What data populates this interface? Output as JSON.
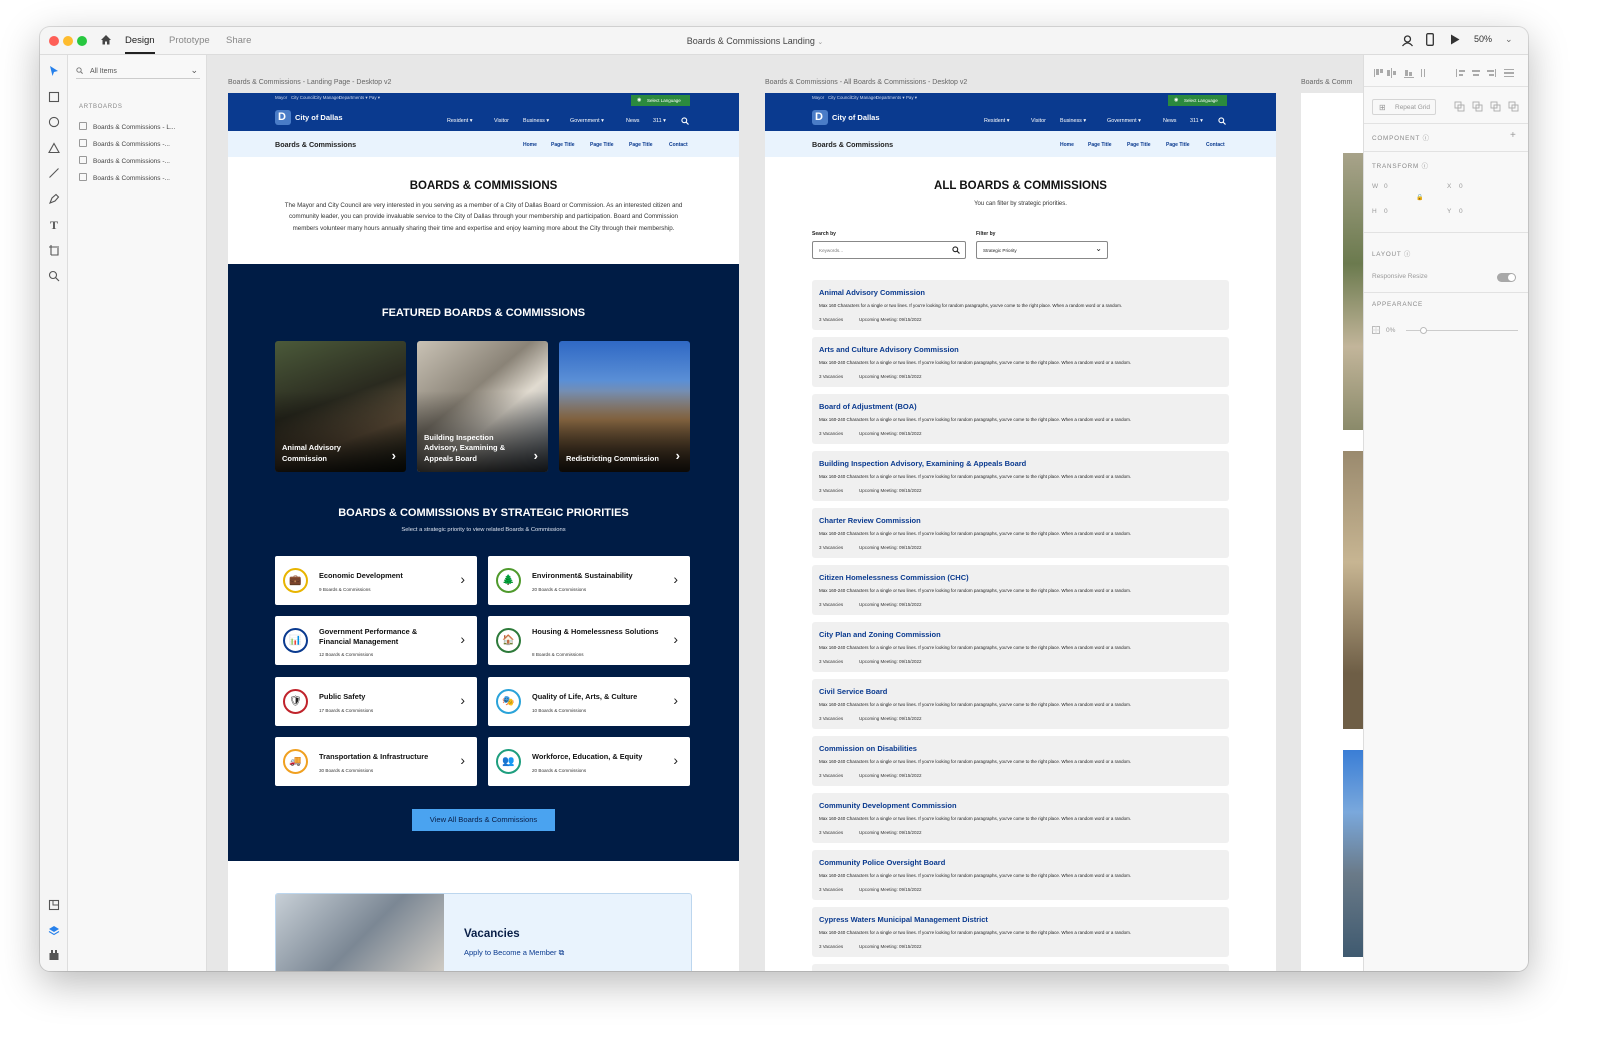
{
  "window": {
    "tabs": [
      "Design",
      "Prototype",
      "Share"
    ],
    "doc_title": "Boards & Commissions Landing",
    "zoom": "50%"
  },
  "layers_panel": {
    "search": "All Items",
    "heading": "ARTBOARDS",
    "items": [
      "Boards & Commissions - L...",
      "Boards & Commissions -...",
      "Boards & Commissions -...",
      "Boards & Commissions -..."
    ]
  },
  "artboard_labels": [
    "Boards & Commissions - Landing Page - Desktop v2",
    "Boards & Commissions - All Boards & Commissions - Desktop v2",
    "Boards & Comm"
  ],
  "site": {
    "util_links": [
      "Mayor",
      "City Council",
      "City Manager",
      "Departments ▾",
      "Pay ▾"
    ],
    "select_language": "Select Language",
    "city_name": "City of Dallas",
    "nav": [
      "Resident ▾",
      "Visitor",
      "Business ▾",
      "Government ▾",
      "News",
      "311 ▾"
    ],
    "section_title": "Boards & Commissions",
    "sub_nav": [
      "Home",
      "Page Title",
      "Page Title",
      "Page Title",
      "Contact"
    ]
  },
  "landing": {
    "title": "BOARDS & COMMISSIONS",
    "intro": "The Mayor and City Council are very interested in you serving as a member of a City of Dallas Board or Commission. As an interested citizen and community leader, you can provide invaluable service to the City of Dallas through your membership and participation. Board and Commission members volunteer many hours annually sharing their time and expertise and enjoy learning more about the City through their membership.",
    "featured_title": "FEATURED BOARDS & COMMISSIONS",
    "featured": [
      "Animal Advisory Commission",
      "Building Inspection Advisory, Examining & Appeals Board",
      "Redistricting Commission"
    ],
    "priorities_title": "BOARDS & COMMISSIONS BY STRATEGIC PRIORITIES",
    "priorities_sub": "Select a strategic priority to view related Boards & Commissions",
    "priorities": [
      {
        "name": "Economic Development",
        "count": "9 Boards & Commissions",
        "icon": "economic-icon",
        "color": "#e8b400"
      },
      {
        "name": "Environment& Sustainability",
        "count": "20 Boards & Commissions",
        "icon": "environment-icon",
        "color": "#4f9a2c"
      },
      {
        "name": "Government Performance & Financial Management",
        "count": "12 Boards & Commissions",
        "icon": "government-icon",
        "color": "#0a3a8f"
      },
      {
        "name": "Housing & Homelessness Solutions",
        "count": "8 Boards & Commissions",
        "icon": "housing-icon",
        "color": "#2d7a3a"
      },
      {
        "name": "Public Safety",
        "count": "17 Boards & Commissions",
        "icon": "shield-icon",
        "color": "#c0232b"
      },
      {
        "name": "Quality of Life, Arts, & Culture",
        "count": "10 Boards & Commissions",
        "icon": "masks-icon",
        "color": "#2aa3d9"
      },
      {
        "name": "Transportation & Infrastructure",
        "count": "30 Boards & Commissions",
        "icon": "transport-icon",
        "color": "#f0a020"
      },
      {
        "name": "Workforce, Education, & Equity",
        "count": "20 Boards & Commissions",
        "icon": "people-icon",
        "color": "#1e9e7e"
      }
    ],
    "view_all": "View All Boards & Commissions",
    "vacancies_title": "Vacancies",
    "vacancies_link": "Apply to Become a Member"
  },
  "all_boards": {
    "title": "ALL BOARDS & COMMISSIONS",
    "subtitle": "You can filter by strategic priorities.",
    "search_label": "Search by",
    "search_placeholder": "Keywords...",
    "filter_label": "Filter by",
    "filter_value": "Strategic Priority",
    "item_desc": "Max 160-240 Characters for a single or two lines. If you're looking for random paragraphs, you've come to the right place. When a random word or a random.",
    "item_vacancies": "3 Vacancies",
    "item_meeting": "Upcoming Meeting: 09/15/2022",
    "first_desc": "Max 160 Characters for a single or two lines. If you're looking for random paragraphs, you've come to the right place. When a random word or a random.",
    "items": [
      "Animal Advisory Commission",
      "Arts and Culture Advisory Commission",
      "Board of Adjustment (BOA)",
      "Building Inspection Advisory, Examining & Appeals Board",
      "Charter Review Commission",
      "Citizen Homelessness Commission (CHC)",
      "City Plan and Zoning Commission",
      "Civil Service Board",
      "Commission on Disabilities",
      "Community Development Commission",
      "Community Police Oversight Board",
      "Cypress Waters Municipal Management District"
    ]
  },
  "inspector": {
    "repeat_grid": "Repeat Grid",
    "component": "COMPONENT",
    "transform": "TRANSFORM",
    "w": "W",
    "w_val": "0",
    "x": "X",
    "x_val": "0",
    "h": "H",
    "h_val": "0",
    "y": "Y",
    "y_val": "0",
    "layout": "LAYOUT",
    "responsive_resize": "Responsive Resize",
    "appearance": "APPEARANCE",
    "opacity": "0%"
  }
}
